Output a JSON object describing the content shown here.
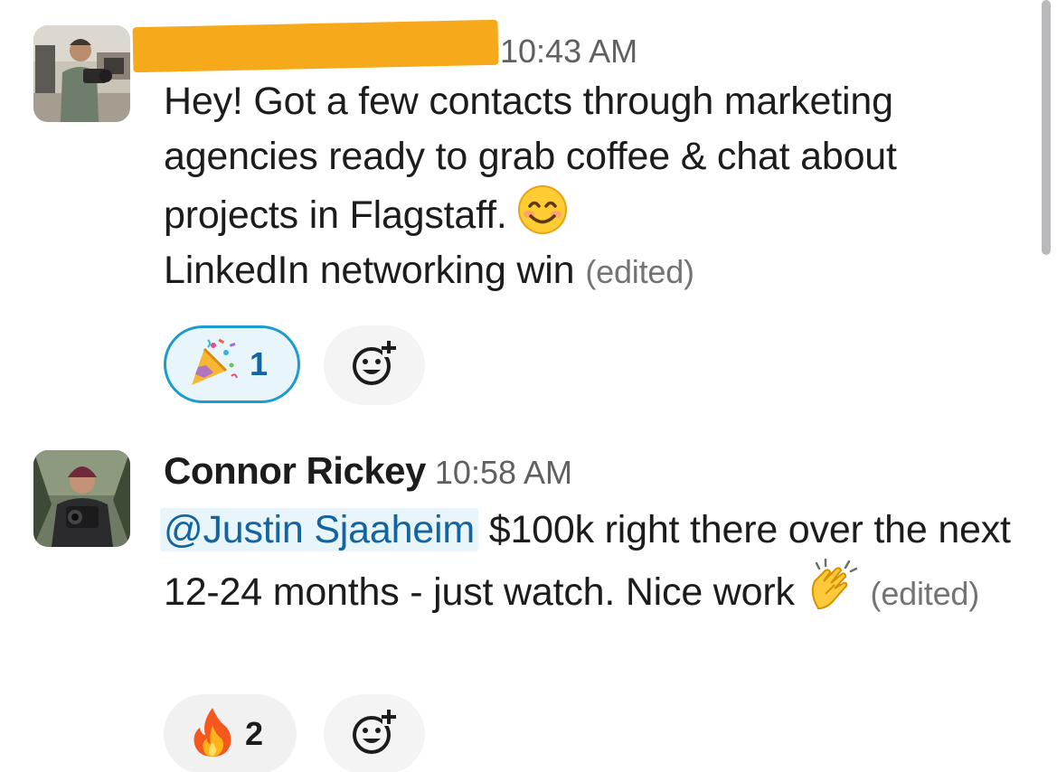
{
  "messages": [
    {
      "sender": "",
      "sender_redacted": true,
      "timestamp": "10:43 AM",
      "text_main": "Hey! Got a few contacts through marketing agencies ready to grab coffee & chat about projects in Flagstaff.",
      "emoji_1": "smiling-face-icon",
      "text_after": "LinkedIn networking win",
      "edited": "(edited)",
      "reactions": [
        {
          "emoji": "party-popper-icon",
          "count": "1",
          "reacted_by_me": true
        }
      ],
      "add_reaction": "add-reaction-icon"
    },
    {
      "sender": "Connor Rickey",
      "timestamp": "10:58 AM",
      "mention": "@Justin Sjaaheim",
      "text_main": "$100k right there over the next 12-24 months - just watch. Nice work",
      "emoji_1": "clapping-hands-icon",
      "edited": "(edited)",
      "reactions": [
        {
          "emoji": "fire-icon",
          "count": "2",
          "reacted_by_me": false
        }
      ],
      "add_reaction": "add-reaction-icon"
    }
  ],
  "colors": {
    "mention_text": "#1264a3",
    "mention_bg": "#e8f5fa",
    "active_reaction_border": "#1d9bd1",
    "redaction": "#f6a91a",
    "timestamp": "#616061"
  }
}
